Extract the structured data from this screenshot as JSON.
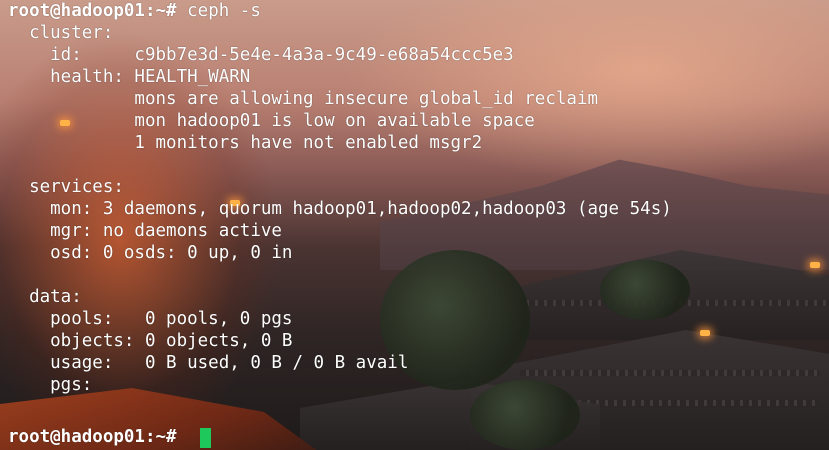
{
  "terminal": {
    "prompt": "root@hadoop01:~#",
    "command": "ceph -s",
    "lines": [
      "  cluster:",
      "    id:     c9bb7e3d-5e4e-4a3a-9c49-e68a54ccc5e3",
      "    health: HEALTH_WARN",
      "            mons are allowing insecure global_id reclaim",
      "            mon hadoop01 is low on available space",
      "            1 monitors have not enabled msgr2",
      "",
      "  services:",
      "    mon: 3 daemons, quorum hadoop01,hadoop02,hadoop03 (age 54s)",
      "    mgr: no daemons active",
      "    osd: 0 osds: 0 up, 0 in",
      "",
      "  data:",
      "    pools:   0 pools, 0 pgs",
      "    objects: 0 objects, 0 B",
      "    usage:   0 B used, 0 B / 0 B avail",
      "    pgs:"
    ],
    "final_prompt": "root@hadoop01:~#",
    "cursor_color": "#1ec85a",
    "text_color": "#ffffff"
  }
}
